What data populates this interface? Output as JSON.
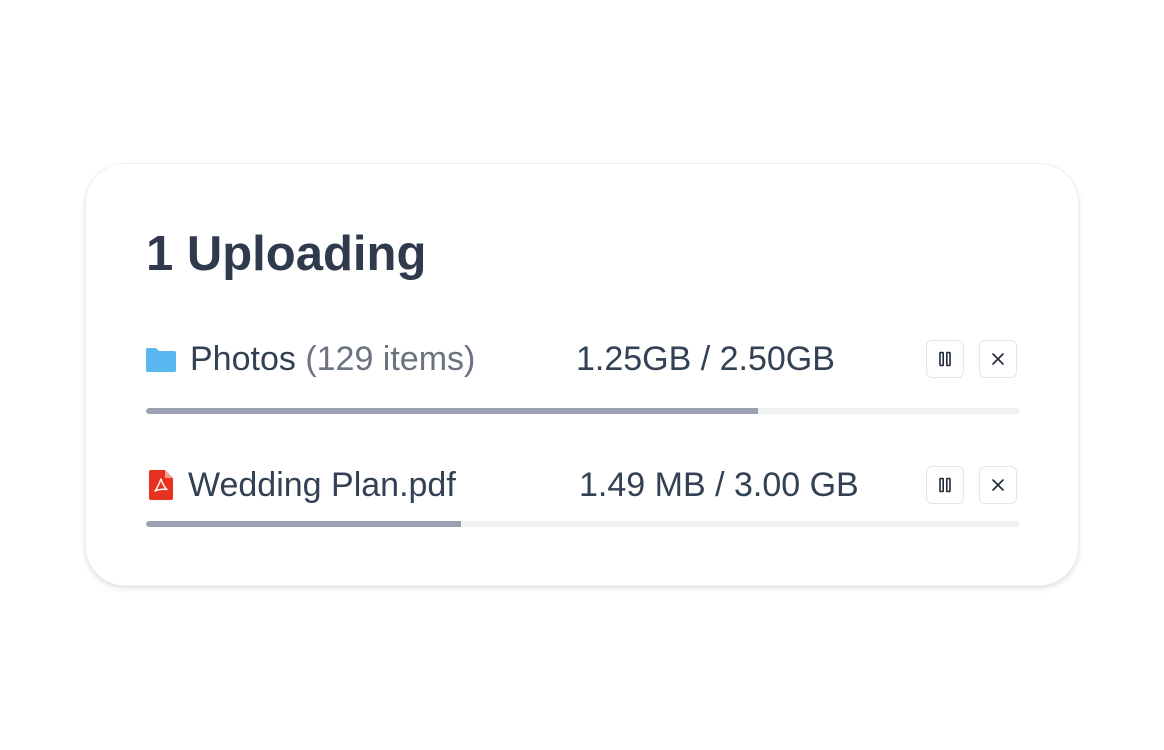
{
  "upload_panel": {
    "title": "1 Uploading",
    "accent_color": "#9aa1b0",
    "items": [
      {
        "icon": "folder-icon",
        "icon_color": "#5ab8f0",
        "name": "Photos",
        "count": "(129 items)",
        "size": "1.25GB / 2.50GB",
        "progress": 0.7
      },
      {
        "icon": "pdf-icon",
        "icon_color": "#e8321f",
        "name": "Wedding Plan.pdf",
        "count": "",
        "size": "1.49 MB / 3.00 GB",
        "progress": 0.36
      }
    ]
  }
}
